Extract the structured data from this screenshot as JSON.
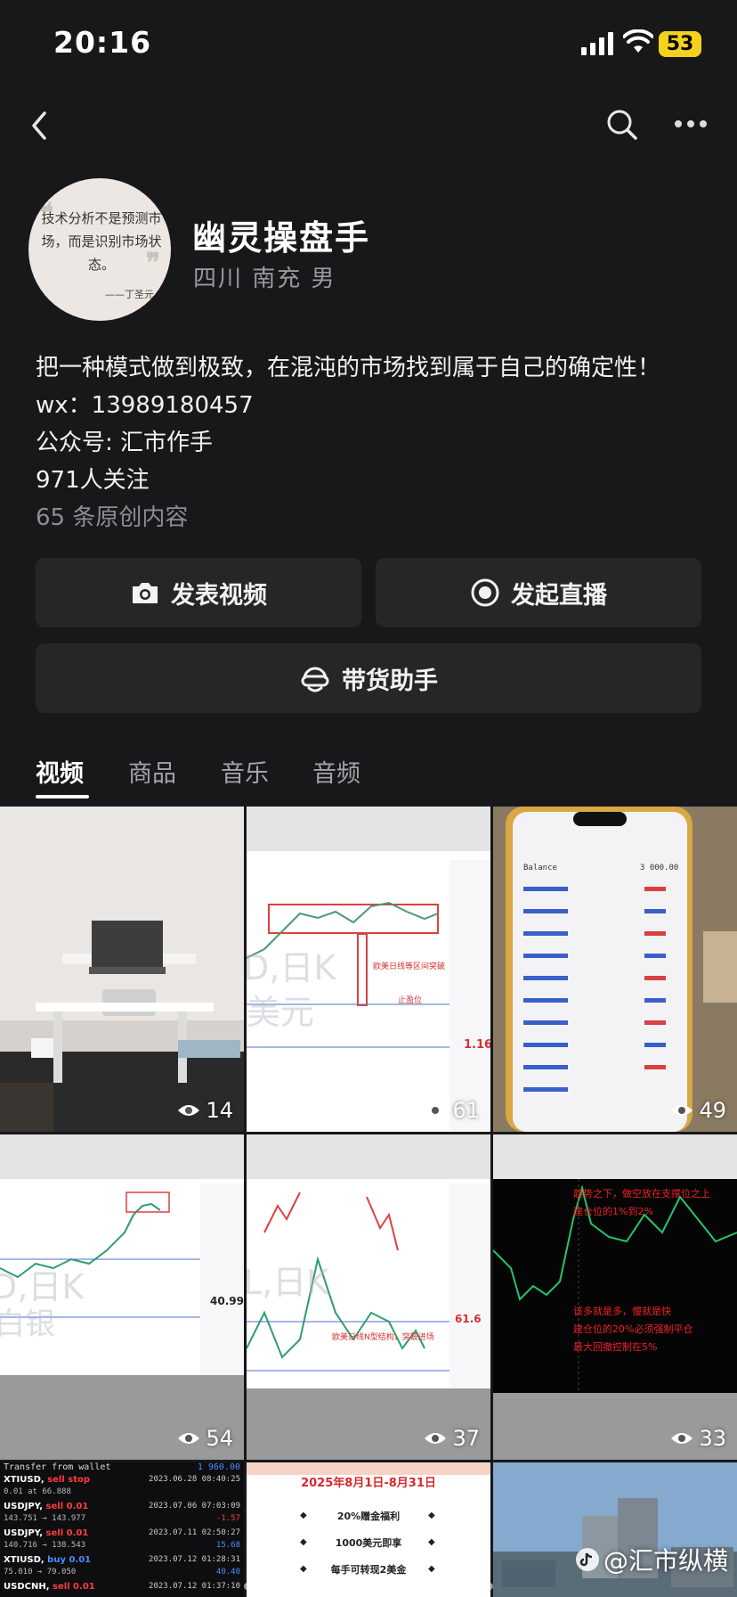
{
  "status_bar": {
    "time": "20:16",
    "battery": "53"
  },
  "profile": {
    "name": "幽灵操盘手",
    "location": "四川 南充 男",
    "avatar_quote": "技术分析不是预测市场，而是识别市场状态。",
    "avatar_author": "——丁圣元"
  },
  "bio": {
    "line1": "把一种模式做到极致，在混沌的市场找到属于自己的确定性！",
    "line2": "wx：13989180457",
    "line3": "公众号: 汇市作手",
    "line4": "971人关注",
    "original_count": "65 条原创内容"
  },
  "actions": {
    "post_video": "发表视频",
    "start_live": "发起直播",
    "sales_assistant": "带货助手"
  },
  "tabs": [
    {
      "label": "视频"
    },
    {
      "label": "商品"
    },
    {
      "label": "音乐"
    },
    {
      "label": "音频"
    }
  ],
  "videos": [
    {
      "views": "14"
    },
    {
      "views": "61",
      "overlay_big": "D,日K",
      "overlay_big2": "美元",
      "annotation1": "欧美日线等区间突破",
      "annotation2": "止盈位",
      "price": "1.160"
    },
    {
      "views": "49",
      "header": "Balance",
      "balance": "3 000.00"
    },
    {
      "views": "54",
      "overlay_big": "D,日K",
      "overlay_big2": "白银",
      "price": "40.993"
    },
    {
      "views": "37",
      "overlay_big": "L,日K",
      "annotation1": "欧美日线N型结构，突破进场",
      "price": "61.6"
    },
    {
      "views": "33",
      "text1": "趋势之下，做空放在支撑位之上",
      "text2": "建仓位的1%到2%",
      "text3": "该多就是多，慢就是快",
      "text4": "建仓位的20%必须强制平仓",
      "text5": "最大回撤控制在5%"
    },
    {
      "views": "",
      "rows": [
        {
          "sym": "Transfer from wallet",
          "act": "",
          "val": "1 960.00"
        },
        {
          "sym": "XTIUSD,",
          "act": "sell stop",
          "date": "2023.06.28 08:40:25",
          "detail": "0.01 at 66.888",
          "val": ""
        },
        {
          "sym": "USDJPY,",
          "act": "sell 0.01",
          "date": "2023.07.06 07:03:09",
          "detail": "143.751 → 143.977",
          "val": "-1.57"
        },
        {
          "sym": "USDJPY,",
          "act": "sell 0.01",
          "date": "2023.07.11 02:50:27",
          "detail": "140.716 → 138.543",
          "val": "15.68"
        },
        {
          "sym": "XTIUSD,",
          "act": "buy 0.01",
          "date": "2023.07.12 01:28:31",
          "detail": "75.010 → 79.050",
          "val": "40.40"
        },
        {
          "sym": "USDCNH,",
          "act": "sell 0.01",
          "date": "2023.07.12 01:37:10",
          "detail": "",
          "val": ""
        }
      ]
    },
    {
      "views": "",
      "banner": "2025年8月1日-8月31日",
      "items": [
        "20%赠金福利",
        "1000美元即享",
        "每手可转现2美金"
      ]
    },
    {
      "views": ""
    }
  ],
  "watermark": "@汇市纵横",
  "colors": {
    "background": "#18181a",
    "button": "#262628",
    "muted": "#9a9a9e",
    "battery": "#f4d11c"
  }
}
